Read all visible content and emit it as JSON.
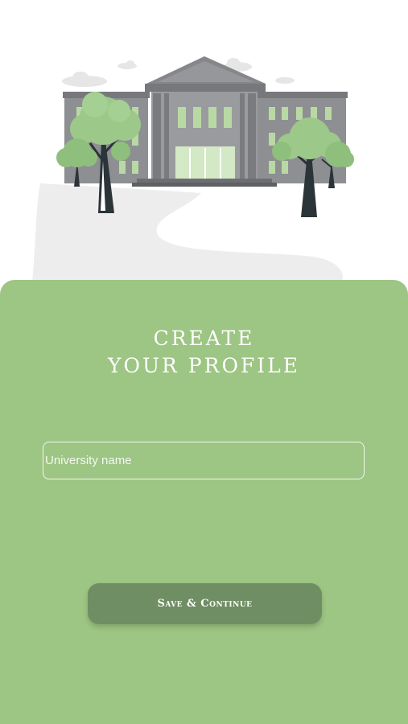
{
  "hero": {
    "illustration": "university-building-with-trees"
  },
  "form": {
    "title_line_1": "CREATE",
    "title_line_2": "YOUR PROFILE",
    "university_field": {
      "value": "",
      "placeholder": "University name"
    },
    "submit_label": "Save & Continue"
  },
  "colors": {
    "panel": "#9dc583",
    "button": "#6f8e63",
    "building": "#8e8f92",
    "tree_foliage": "#9cc98a",
    "path": "#f1f1f1"
  }
}
